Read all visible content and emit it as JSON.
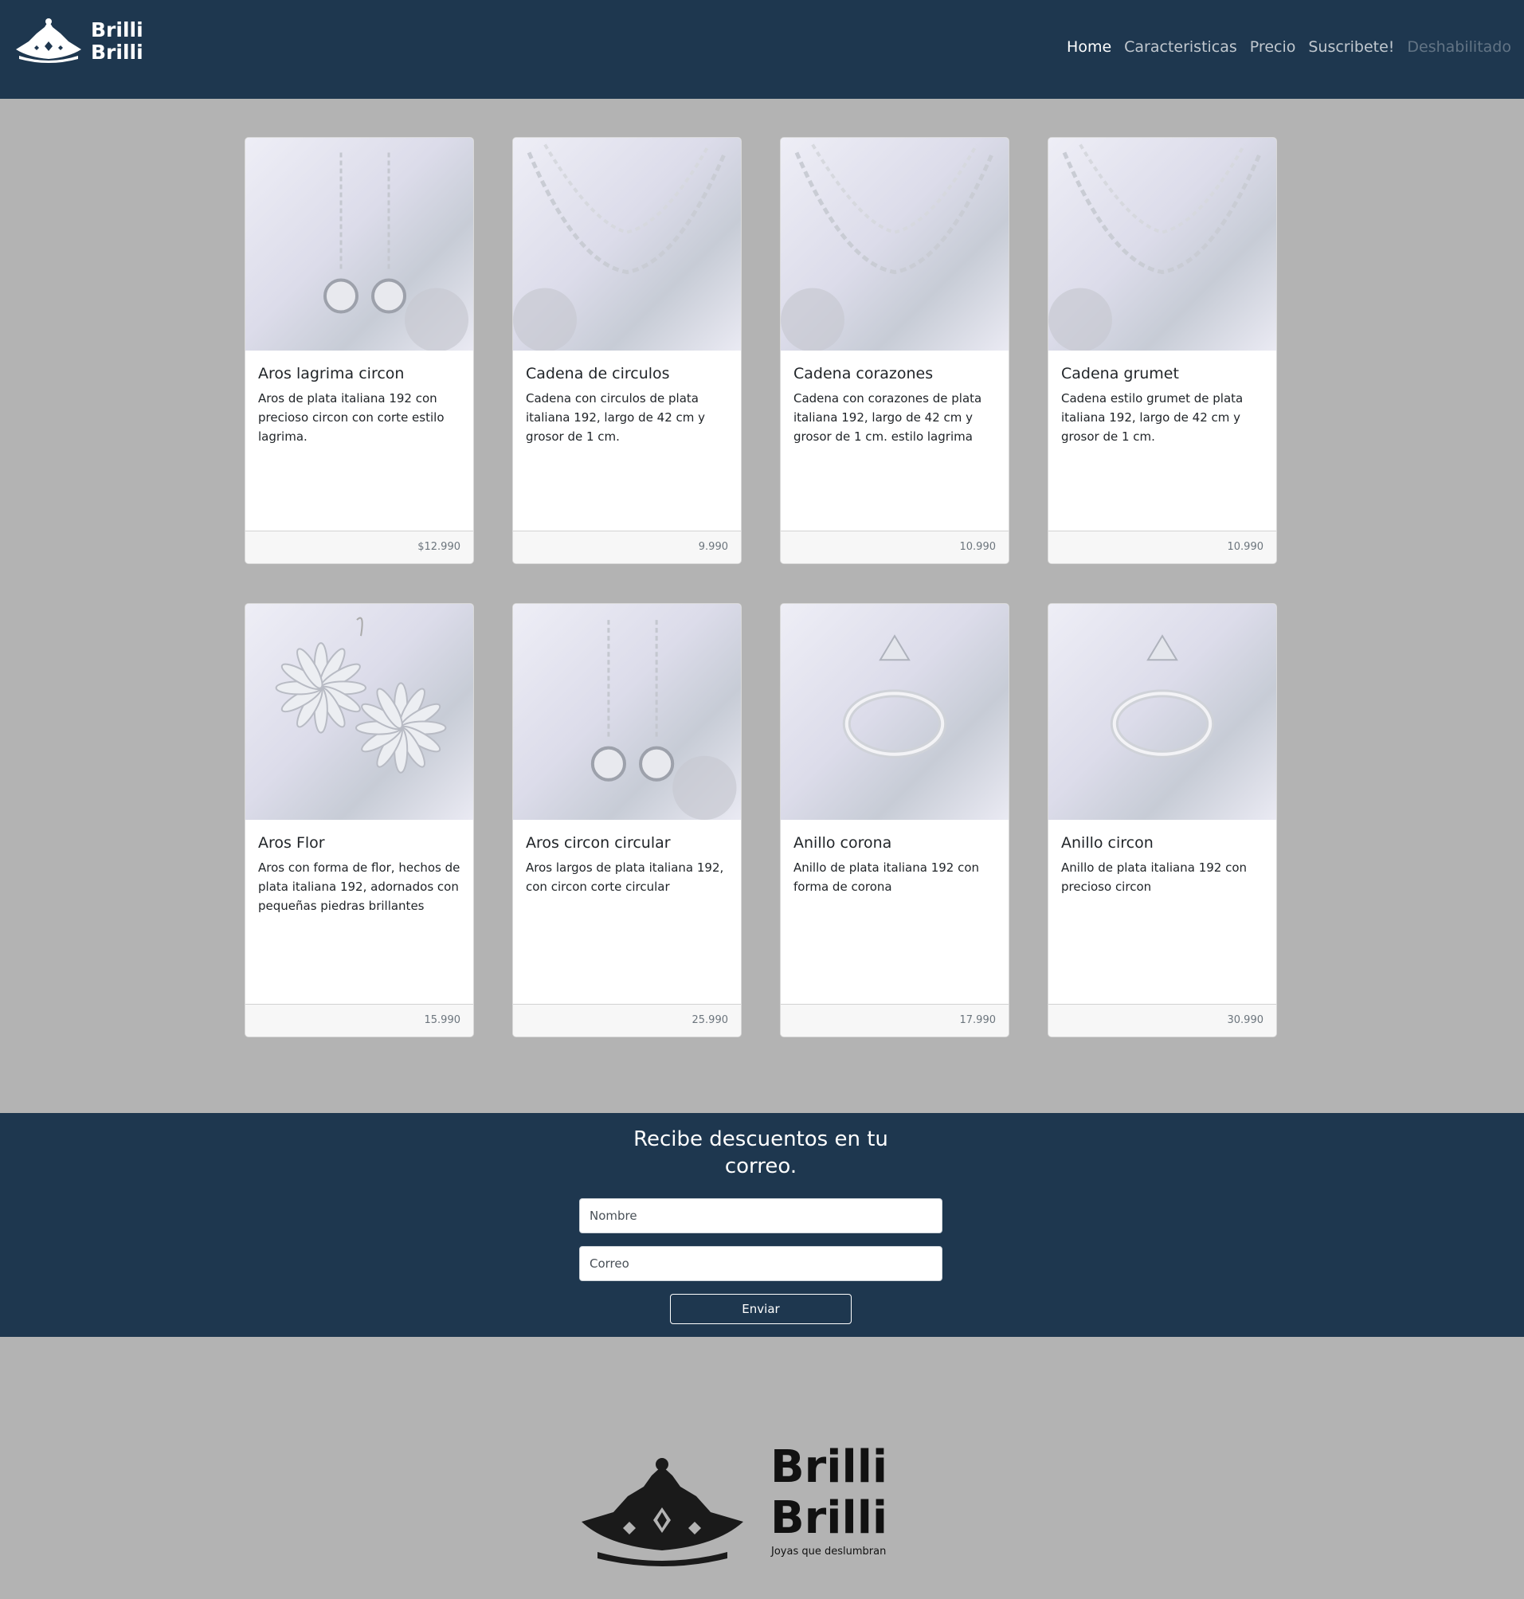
{
  "brand": {
    "line1": "Brilli",
    "line2": "Brilli"
  },
  "nav": {
    "home": "Home",
    "features": "Caracteristicas",
    "pricing": "Precio",
    "subscribe": "Suscribete!",
    "disabled": "Deshabilitado"
  },
  "products": [
    {
      "title": "Aros lagrima circon",
      "text": "Aros de plata italiana 192 con precioso circon con corte estilo lagrima.",
      "price": "$12.990",
      "icon": "earring-icon"
    },
    {
      "title": "Cadena de circulos",
      "text": "Cadena con circulos de plata italiana 192, largo de 42 cm y grosor de 1 cm.",
      "price": "9.990",
      "icon": "necklace-icon"
    },
    {
      "title": "Cadena corazones",
      "text": "Cadena con corazones de plata italiana 192, largo de 42 cm y grosor de 1 cm. estilo lagrima",
      "price": "10.990",
      "icon": "necklace-icon"
    },
    {
      "title": "Cadena grumet",
      "text": "Cadena estilo grumet de plata italiana 192, largo de 42 cm y grosor de 1 cm.",
      "price": "10.990",
      "icon": "necklace-icon"
    },
    {
      "title": "Aros Flor",
      "text": "Aros con forma de flor, hechos de plata italiana 192, adornados con pequeñas piedras brillantes",
      "price": "15.990",
      "icon": "flower-earring-icon"
    },
    {
      "title": "Aros circon circular",
      "text": "Aros largos de plata italiana 192, con circon corte circular",
      "price": "25.990",
      "icon": "earring-icon"
    },
    {
      "title": "Anillo corona",
      "text": "Anillo de plata italiana 192 con forma de corona",
      "price": "17.990",
      "icon": "ring-icon"
    },
    {
      "title": "Anillo circon",
      "text": "Anillo de plata italiana 192 con precioso circon",
      "price": "30.990",
      "icon": "ring-icon"
    }
  ],
  "subscribe": {
    "title": "Recibe descuentos en tu correo.",
    "name_placeholder": "Nombre",
    "email_placeholder": "Correo",
    "button": "Enviar"
  },
  "footer": {
    "line1": "Brilli",
    "line2": "Brilli",
    "tagline": "Joyas que deslumbran"
  },
  "colors": {
    "navbar": "#1e374f",
    "background": "#b3b3b3"
  }
}
